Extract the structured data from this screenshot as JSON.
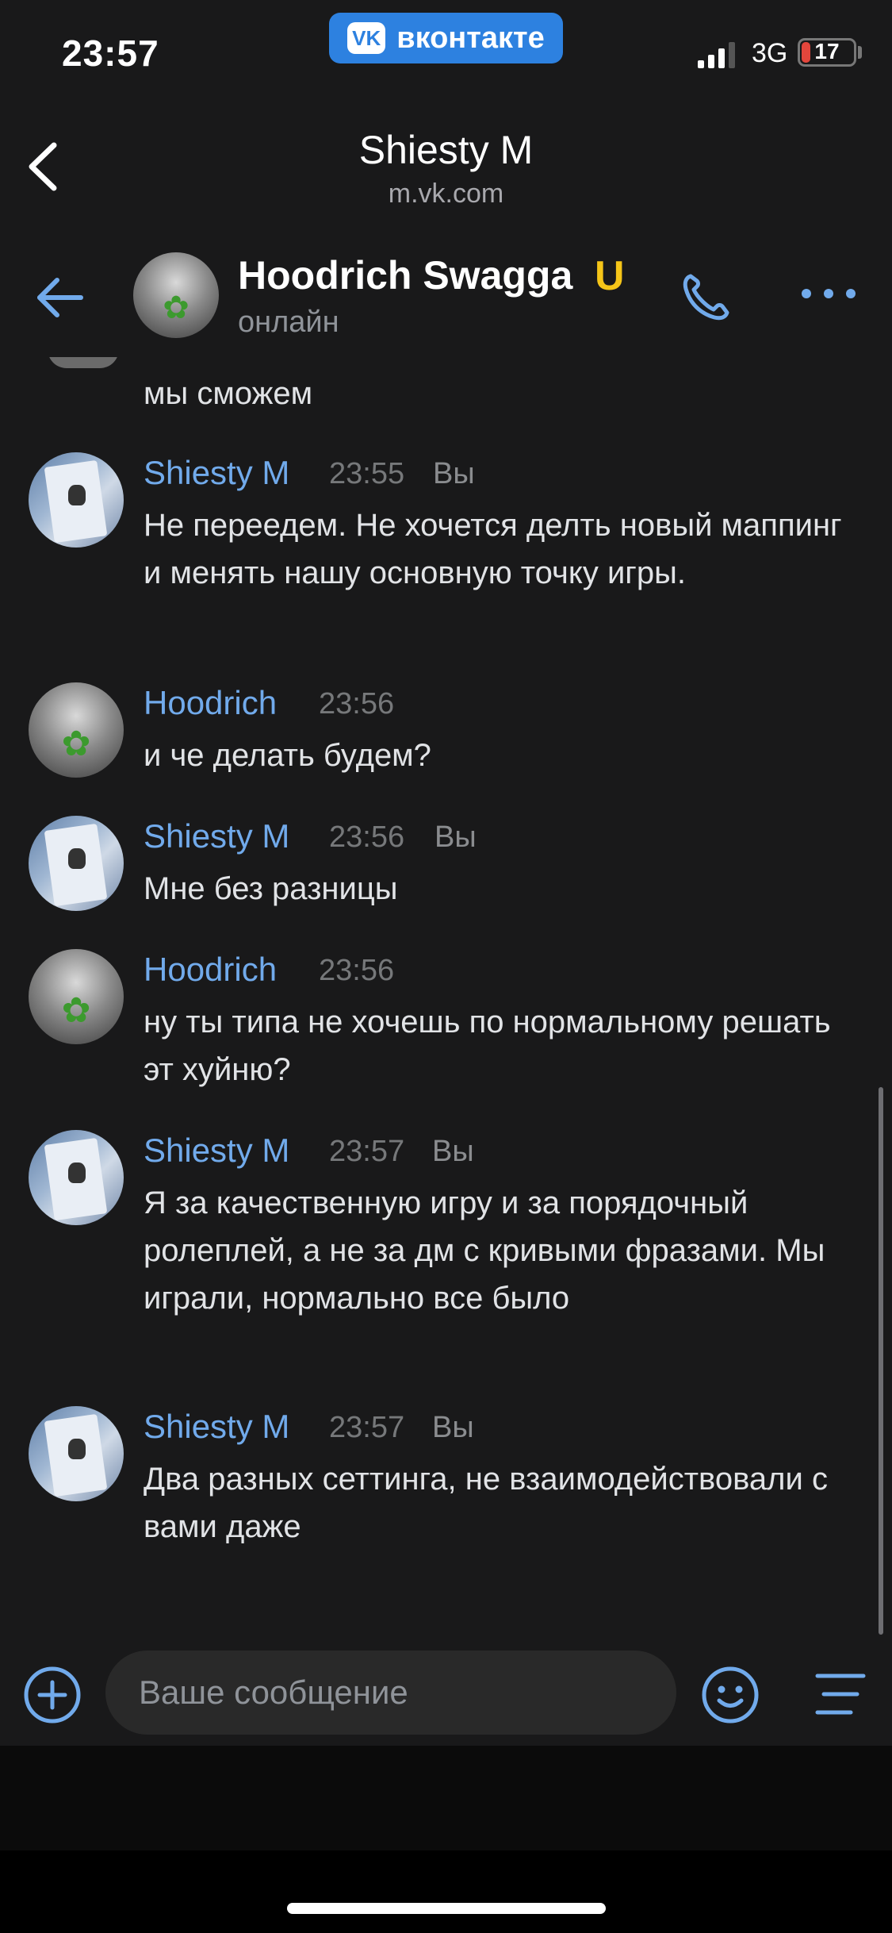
{
  "status_bar": {
    "time": "23:57",
    "app_pill_logo": "VK",
    "app_pill_label": "вконтакте",
    "signal_icon": "cellular-signal-icon",
    "network": "3G",
    "battery_label": "17",
    "battery_level_percent": 17
  },
  "browser": {
    "title": "Shiesty M",
    "url": "m.vk.com"
  },
  "chat_header": {
    "name": "Hoodrich Swagga",
    "badge": "U",
    "status": "онлайн",
    "colors": {
      "accent": "#71aaeb",
      "background": "#19191a"
    }
  },
  "messages": {
    "partial_text": "мы сможем",
    "items": [
      {
        "author": "Shiesty M",
        "time": "23:55",
        "you": "Вы",
        "text": "Не переедем. Не хочется делть новый маппинг и менять нашу основную точку игры."
      },
      {
        "author": "Hoodrich",
        "time": "23:56",
        "text": "и че делать будем?"
      },
      {
        "author": "Shiesty M",
        "time": "23:56",
        "you": "Вы",
        "text": "Мне без разницы"
      },
      {
        "author": "Hoodrich",
        "time": "23:56",
        "text": "ну ты типа не хочешь по нормальному решать эт хуйню?"
      },
      {
        "author": "Shiesty M",
        "time": "23:57",
        "you": "Вы",
        "text": "Я за качественную игру и за порядочный ролеплей, а не за дм с кривыми фразами. Мы играли, нормально все было"
      },
      {
        "author": "Shiesty M",
        "time": "23:57",
        "you": "Вы",
        "text": "Два разных сеттинга, не взаимодействовали с вами даже"
      }
    ]
  },
  "composer": {
    "placeholder": "Ваше сообщение"
  }
}
